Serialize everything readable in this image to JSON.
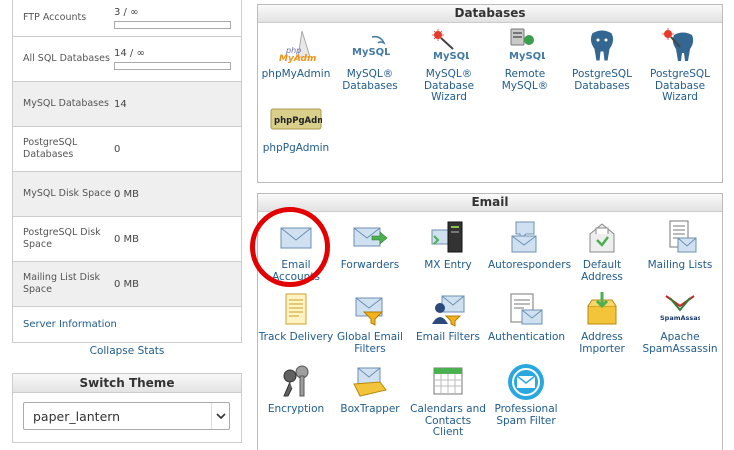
{
  "stats": {
    "rows": [
      {
        "label": "FTP Accounts",
        "value": "3 / ∞"
      },
      {
        "label": "All SQL Databases",
        "value": "14 / ∞"
      },
      {
        "label": "MySQL Databases",
        "value": "14"
      },
      {
        "label": "PostgreSQL Databases",
        "value": "0"
      },
      {
        "label": "MySQL Disk Space",
        "value": "0 MB"
      },
      {
        "label": "PostgreSQL Disk Space",
        "value": "0 MB"
      },
      {
        "label": "Mailing List Disk Space",
        "value": "0 MB"
      }
    ],
    "server_info": "Server Information",
    "collapse": "Collapse Stats"
  },
  "theme": {
    "title": "Switch Theme",
    "selected": "paper_lantern"
  },
  "databases": {
    "title": "Databases",
    "items": [
      {
        "label": "phpMyAdmin",
        "logo_top": "php",
        "logo_bottom": "MyAdmin"
      },
      {
        "label": "MySQL® Databases",
        "logo": "MySQL"
      },
      {
        "label": "MySQL® Database Wizard",
        "logo": "MySQL"
      },
      {
        "label": "Remote MySQL®",
        "logo": "MySQL"
      },
      {
        "label": "PostgreSQL Databases"
      },
      {
        "label": "PostgreSQL Database Wizard"
      },
      {
        "label": "phpPgAdmin",
        "logo": "phpPgAdmin"
      }
    ]
  },
  "email": {
    "title": "Email",
    "items": [
      {
        "label": "Email Accounts"
      },
      {
        "label": "Forwarders"
      },
      {
        "label": "MX Entry"
      },
      {
        "label": "Autoresponders"
      },
      {
        "label": "Default Address"
      },
      {
        "label": "Mailing Lists"
      },
      {
        "label": "Track Delivery"
      },
      {
        "label": "Global Email Filters"
      },
      {
        "label": "Email Filters"
      },
      {
        "label": "Authentication"
      },
      {
        "label": "Address Importer"
      },
      {
        "label": "Apache SpamAssassin",
        "logo": "SpamAssassin"
      },
      {
        "label": "Encryption"
      },
      {
        "label": "BoxTrapper"
      },
      {
        "label": "Calendars and Contacts Client"
      },
      {
        "label": "Professional Spam Filter"
      }
    ]
  },
  "colors": {
    "link": "#215c8c",
    "highlight": "#e30000"
  }
}
